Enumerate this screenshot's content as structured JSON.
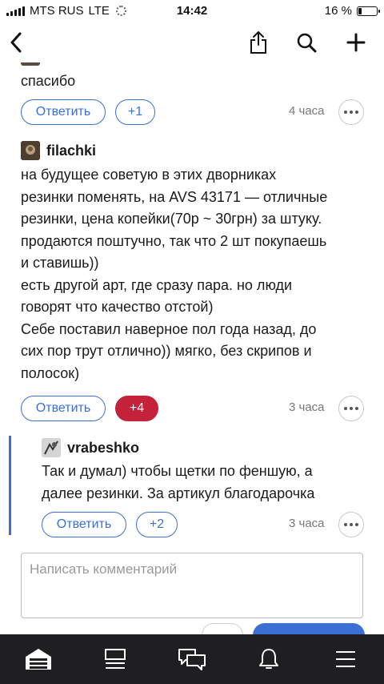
{
  "status_bar": {
    "carrier": "MTS RUS",
    "network": "LTE",
    "time": "14:42",
    "battery": "16 %",
    "battery_level": 0.16
  },
  "navbar": {
    "icons": [
      "back-icon",
      "share-icon",
      "search-icon",
      "add-icon"
    ]
  },
  "comments": [
    {
      "author": "",
      "text_lines": [
        "спасибо"
      ],
      "reply_label": "Ответить",
      "score": "+1",
      "score_style": "outline",
      "time": "4 часа"
    },
    {
      "author": "filachki",
      "text_lines": [
        "на будущее советую в этих дворниках",
        "резинки поменять, на AVS 43171 — отличные",
        "резинки, цена копейки(70р ~ 30грн) за штуку.",
        "продаются поштучно, так что 2 шт покупаешь",
        "и ставишь))",
        "есть другой арт, где сразу пара. но люди",
        "говорят что качество отстой)",
        "Себе поставил наверное пол года назад, до",
        "сих пор трут отлично)) мягко, без скрипов и",
        "полосок)"
      ],
      "reply_label": "Ответить",
      "score": "+4",
      "score_style": "filled",
      "time": "3 часа"
    },
    {
      "author": "vrabeshko",
      "text_lines": [
        "Так и думал) чтобы щетки по феншую, а",
        "далее резинки. За артикул благодарочка"
      ],
      "reply_label": "Ответить",
      "score": "+2",
      "score_style": "outline",
      "time": "3 часа"
    }
  ],
  "compose": {
    "placeholder": "Написать комментарий"
  },
  "tabbar": {
    "items": [
      "garage-icon",
      "feed-icon",
      "messages-icon",
      "notifications-icon",
      "menu-icon"
    ]
  },
  "colors": {
    "accent": "#3b6fd4",
    "score_filled": "#c4213a",
    "tabbar_bg": "#1f1f21",
    "muted": "#777777"
  }
}
